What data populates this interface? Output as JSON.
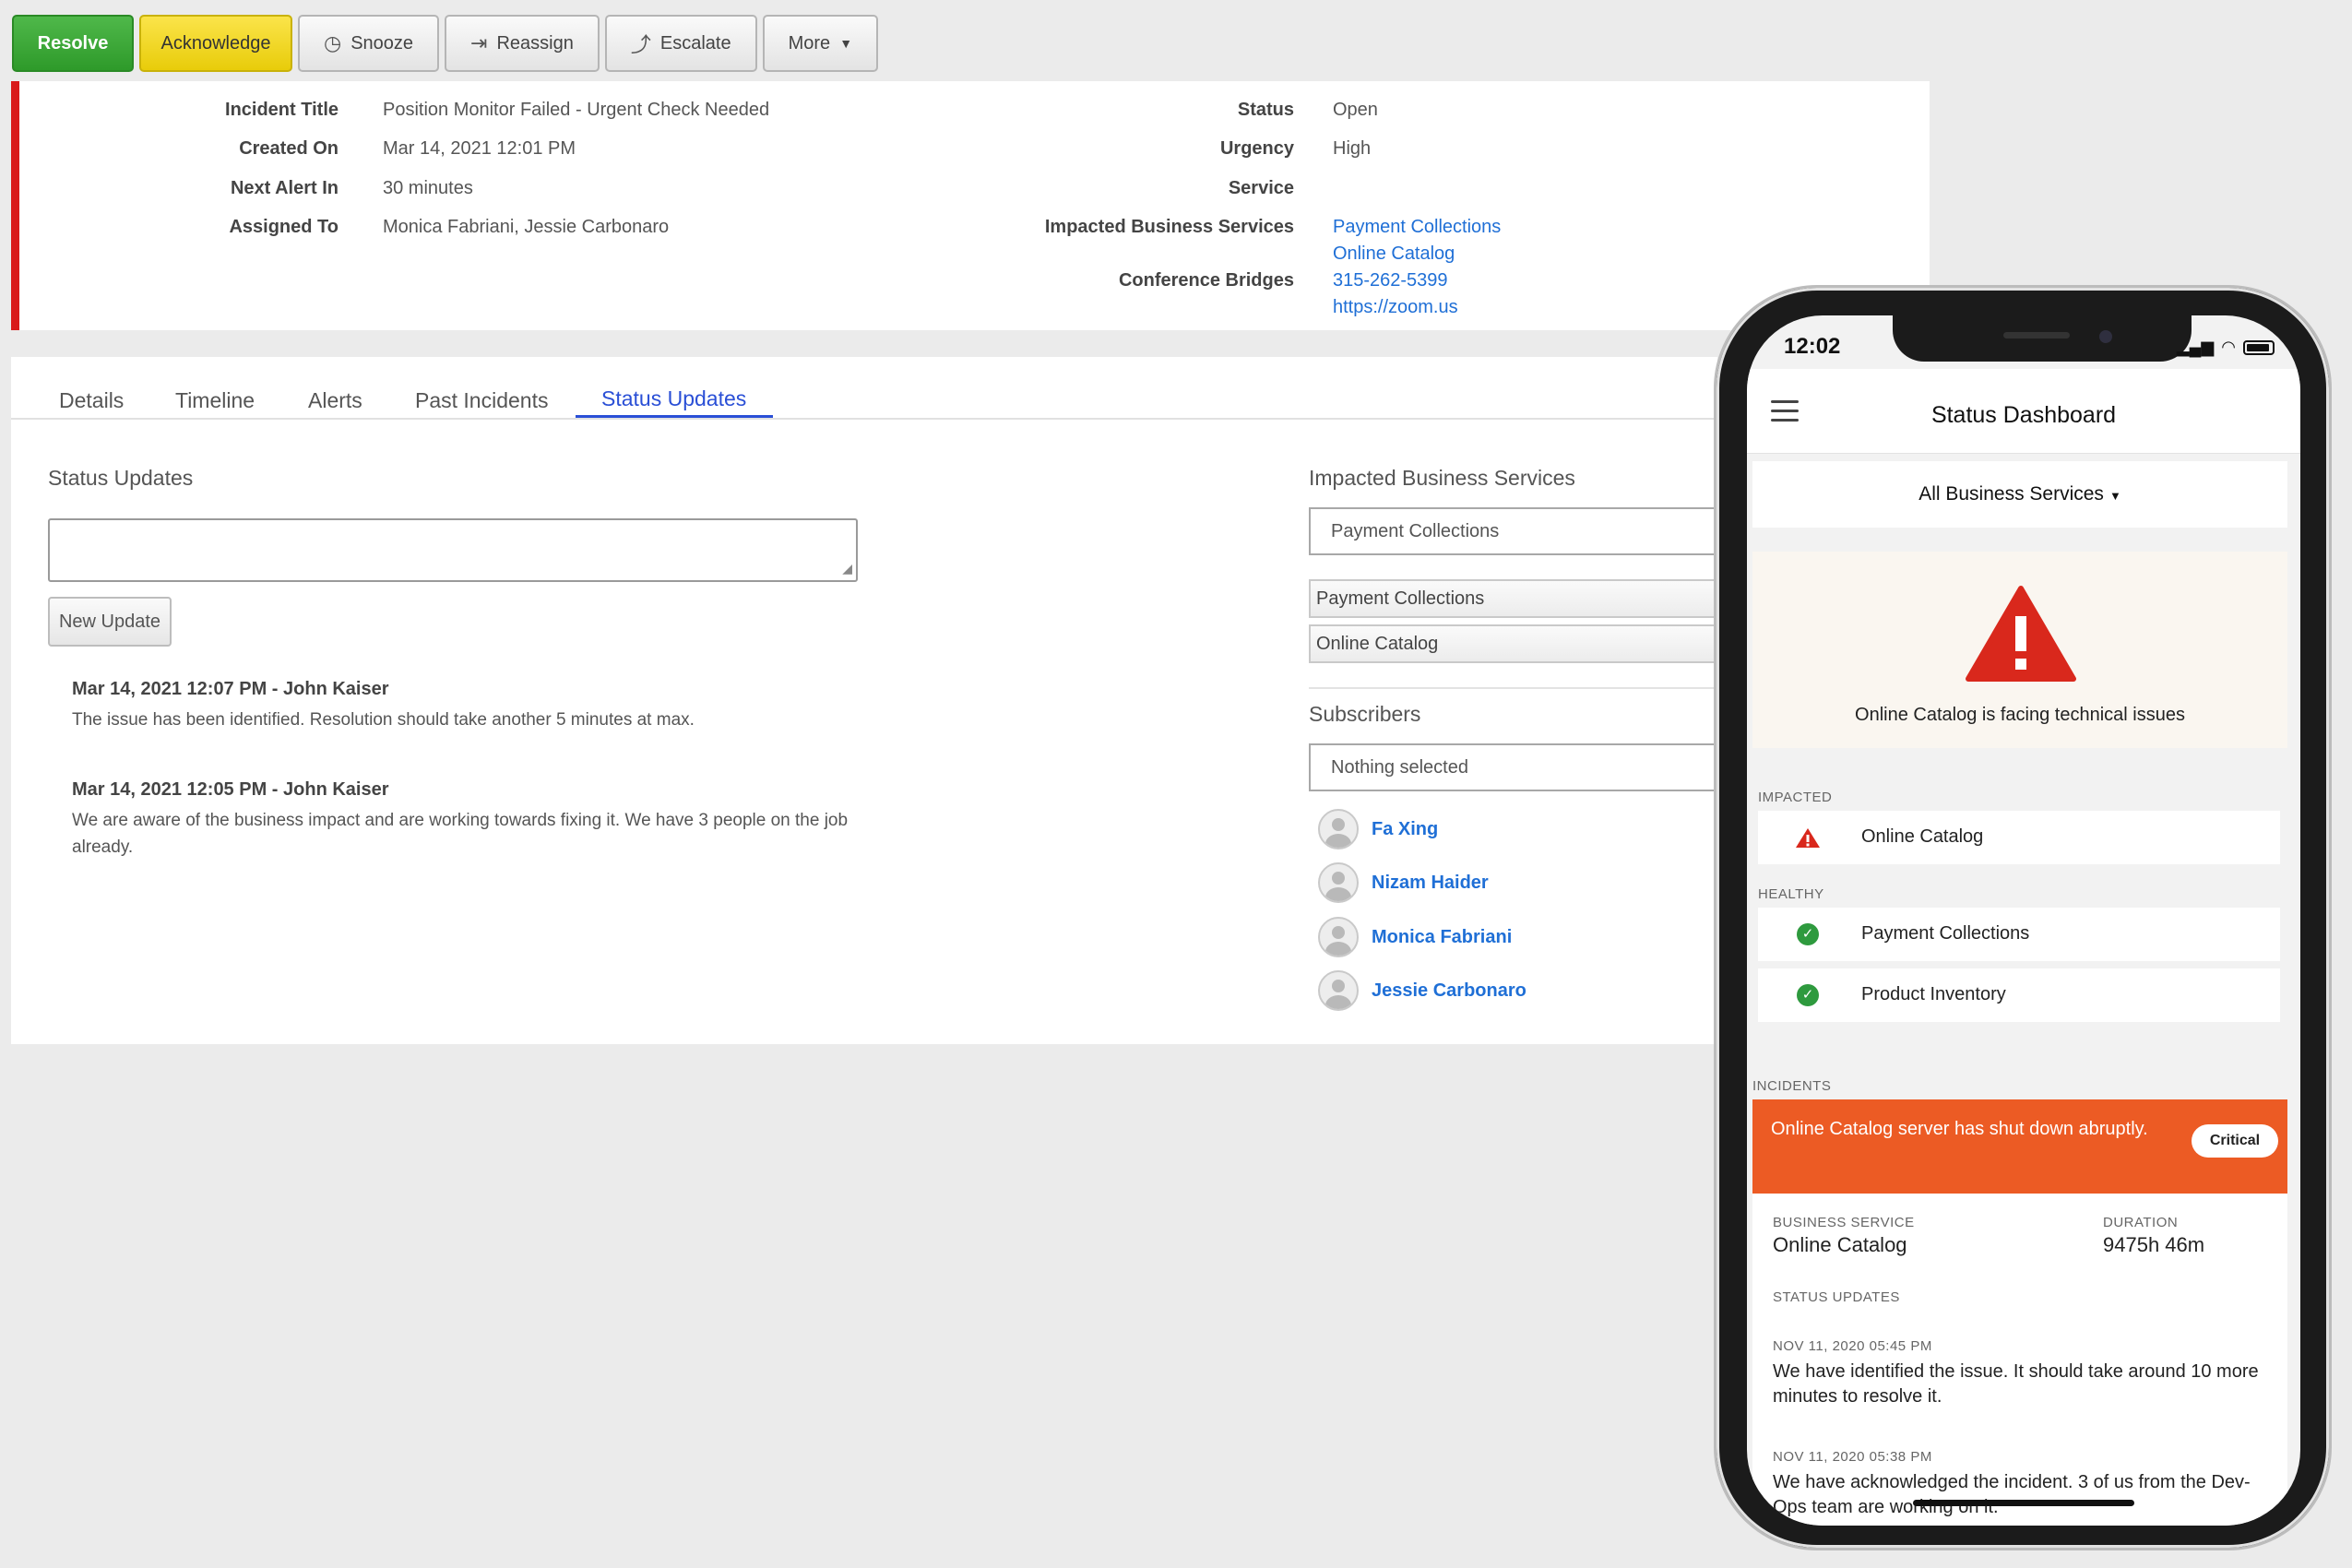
{
  "toolbar": {
    "resolve": "Resolve",
    "acknowledge": "Acknowledge",
    "snooze": "Snooze",
    "reassign": "Reassign",
    "escalate": "Escalate",
    "more": "More"
  },
  "incident": {
    "title_label": "Incident Title",
    "title": "Position Monitor Failed - Urgent Check Needed",
    "created_label": "Created On",
    "created": "Mar 14, 2021 12:01 PM",
    "next_alert_label": "Next Alert In",
    "next_alert": "30 minutes",
    "assigned_label": "Assigned To",
    "assigned": "Monica Fabriani, Jessie Carbonaro",
    "status_label": "Status",
    "status": "Open",
    "urgency_label": "Urgency",
    "urgency": "High",
    "service_label": "Service",
    "impacted_label": "Impacted Business Services",
    "impacted": [
      "Payment Collections",
      "Online Catalog"
    ],
    "bridges_label": "Conference Bridges",
    "bridges": [
      "315-262-5399",
      "https://zoom.us"
    ],
    "accent_color": "#d91a1a"
  },
  "tabs": [
    "Details",
    "Timeline",
    "Alerts",
    "Past Incidents",
    "Status Updates"
  ],
  "status_updates": {
    "title": "Status Updates",
    "new_update": "New Update",
    "updates": [
      {
        "head": "Mar 14, 2021 12:07 PM - John Kaiser",
        "body": "The issue has been identified. Resolution should take another 5 minutes at max."
      },
      {
        "head": "Mar 14, 2021 12:05 PM - John Kaiser",
        "body": "We are aware of the business impact and are working towards fixing it. We have 3 people on the job already."
      }
    ]
  },
  "side": {
    "impacted_title": "Impacted Business Services",
    "select_value": "Payment Collections",
    "services": [
      "Payment Collections",
      "Online Catalog"
    ],
    "subscribers_title": "Subscribers",
    "subscribers_placeholder": "Nothing selected",
    "subscribers": [
      "Fa Xing",
      "Nizam Haider",
      "Monica Fabriani",
      "Jessie Carbonaro"
    ]
  },
  "phone": {
    "time": "12:02",
    "title": "Status Dashboard",
    "filter": "All Business Services",
    "alert_message": "Online Catalog is facing technical issues",
    "impacted_caption": "IMPACTED",
    "impacted": [
      "Online Catalog"
    ],
    "healthy_caption": "HEALTHY",
    "healthy": [
      "Payment Collections",
      "Product Inventory"
    ],
    "incidents_caption": "INCIDENTS",
    "incident_title": "Online Catalog server has shut down abruptly.",
    "incident_badge": "Critical",
    "business_service_caption": "BUSINESS SERVICE",
    "business_service": "Online Catalog",
    "duration_caption": "DURATION",
    "duration": "9475h 46m",
    "status_updates_caption": "STATUS UPDATES",
    "updates": [
      {
        "time": "NOV 11, 2020 05:45 PM",
        "text": "We have identified the issue. It should take around 10 more minutes to resolve it."
      },
      {
        "time": "NOV 11, 2020 05:38 PM",
        "text": "We have acknowledged the incident. 3 of us from the Dev-Ops team are working on it."
      }
    ],
    "incident_color": "#ec5b24",
    "healthy_color": "#2e9a3e",
    "warning_color": "#d9281c"
  }
}
